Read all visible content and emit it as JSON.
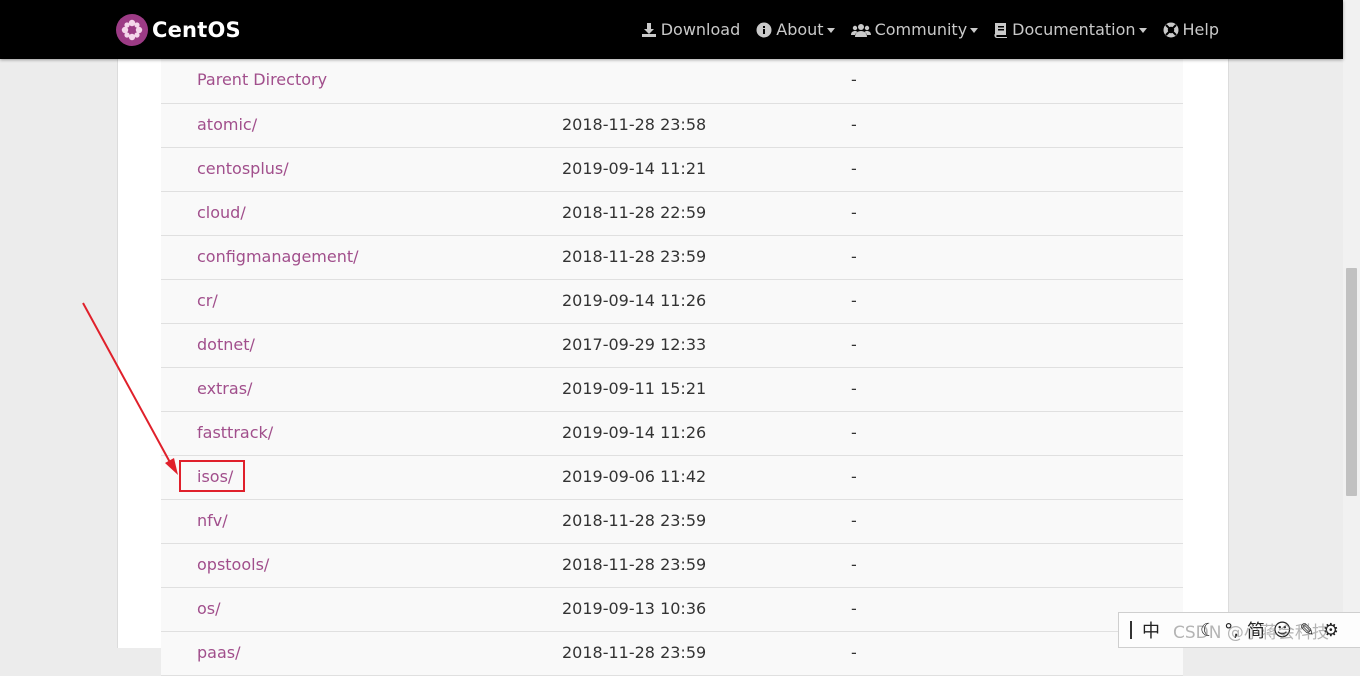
{
  "navbar": {
    "brand": "CentOS",
    "items": [
      {
        "label": "Download",
        "icon": "download-icon",
        "dropdown": false
      },
      {
        "label": "About",
        "icon": "info-icon",
        "dropdown": true
      },
      {
        "label": "Community",
        "icon": "users-icon",
        "dropdown": true
      },
      {
        "label": "Documentation",
        "icon": "book-icon",
        "dropdown": true
      },
      {
        "label": "Help",
        "icon": "lifebuoy-icon",
        "dropdown": false
      }
    ]
  },
  "listing": {
    "rows": [
      {
        "name": "Parent Directory",
        "date": "",
        "size": "-"
      },
      {
        "name": "atomic/",
        "date": "2018-11-28 23:58",
        "size": "-"
      },
      {
        "name": "centosplus/",
        "date": "2019-09-14 11:21",
        "size": "-"
      },
      {
        "name": "cloud/",
        "date": "2018-11-28 22:59",
        "size": "-"
      },
      {
        "name": "configmanagement/",
        "date": "2018-11-28 23:59",
        "size": "-"
      },
      {
        "name": "cr/",
        "date": "2019-09-14 11:26",
        "size": "-"
      },
      {
        "name": "dotnet/",
        "date": "2017-09-29 12:33",
        "size": "-"
      },
      {
        "name": "extras/",
        "date": "2019-09-11 15:21",
        "size": "-"
      },
      {
        "name": "fasttrack/",
        "date": "2019-09-14 11:26",
        "size": "-"
      },
      {
        "name": "isos/",
        "date": "2019-09-06 11:42",
        "size": "-"
      },
      {
        "name": "nfv/",
        "date": "2018-11-28 23:59",
        "size": "-"
      },
      {
        "name": "opstools/",
        "date": "2018-11-28 23:59",
        "size": "-"
      },
      {
        "name": "os/",
        "date": "2019-09-13 10:36",
        "size": "-"
      },
      {
        "name": "paas/",
        "date": "2018-11-28 23:59",
        "size": "-"
      }
    ],
    "highlighted": "isos/"
  },
  "ime_toolbar": {
    "mode": "中",
    "simplified": "简"
  },
  "watermark": "CSDN @小蒋会科技",
  "colors": {
    "navbar_bg": "#000000",
    "link": "#a14f8c",
    "brand_logo": "#9c3b85",
    "annotation": "#e0202b"
  }
}
